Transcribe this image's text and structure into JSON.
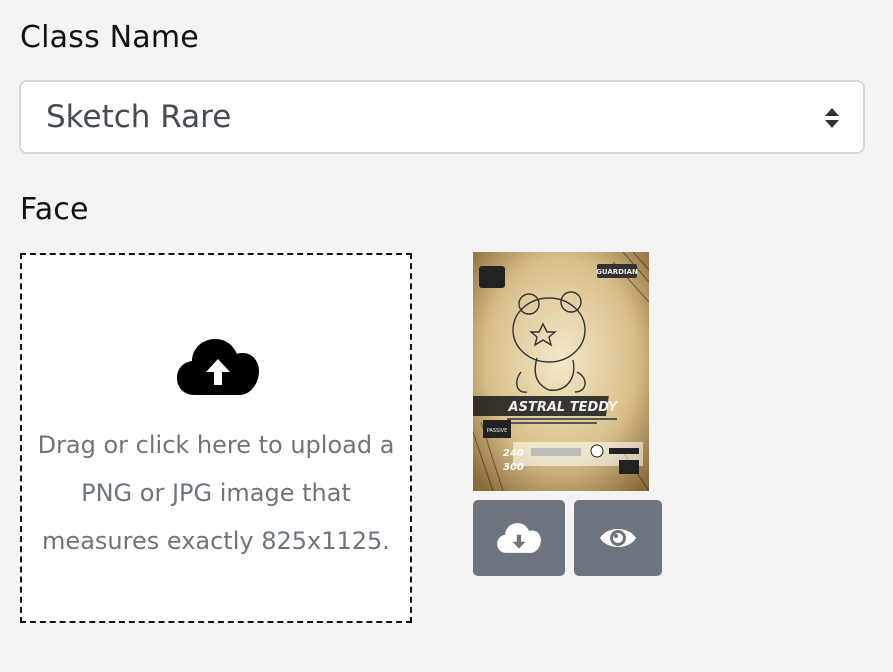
{
  "class_field": {
    "label": "Class Name",
    "selected": "Sketch Rare"
  },
  "face_field": {
    "label": "Face",
    "dropzone_text": "Drag or click here to upload a PNG or JPG image that measures exactly 825x1125.",
    "upload_icon": "cloud-upload-icon"
  },
  "card_preview": {
    "name": "ASTRAL TEDDY",
    "badge": "GUARDIAN",
    "stat_attack": "240",
    "stat_health": "300",
    "passive_label": "PASSIVE"
  },
  "actions": {
    "download_icon": "cloud-download-icon",
    "preview_icon": "eye-icon"
  },
  "colors": {
    "background": "#f4f4f4",
    "button": "#6c757d",
    "placeholder_text": "#6c757d",
    "border": "#d4d7db"
  }
}
